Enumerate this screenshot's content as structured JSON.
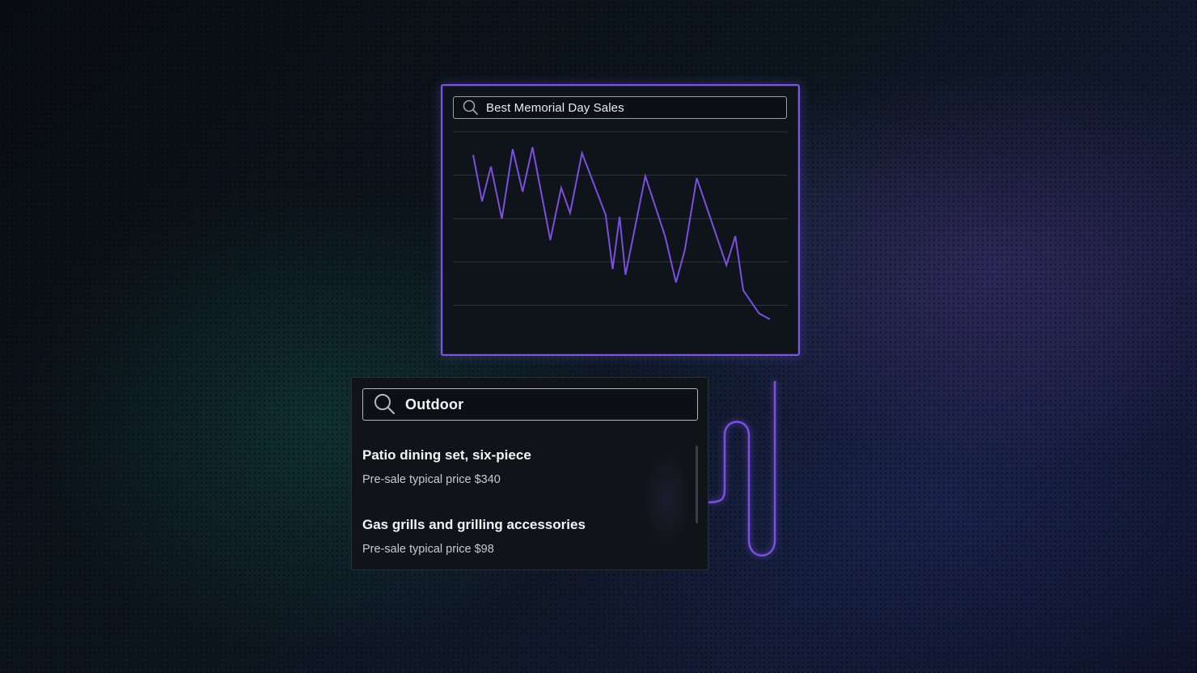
{
  "chart_card": {
    "search_query": "Best Memorial Day Sales",
    "search_icon": "search-icon"
  },
  "chart_data": {
    "type": "line",
    "grid": true,
    "gridlines": 5,
    "ylim": [
      0,
      100
    ],
    "series": [
      {
        "color": "#7b4fe0",
        "values": [
          96,
          72,
          90,
          63,
          99,
          77,
          100,
          52,
          79,
          66,
          97,
          65,
          37,
          64,
          34,
          85,
          54,
          30,
          47,
          84,
          39,
          54,
          26,
          14,
          11
        ]
      }
    ],
    "x": [
      0,
      4.5,
      9,
      14.5,
      20,
      25,
      30,
      39,
      44.5,
      49,
      55,
      67,
      70.5,
      74,
      77,
      87,
      97,
      102.5,
      107,
      113,
      128,
      132.5,
      136.5,
      144.5,
      150
    ]
  },
  "results_card": {
    "search_query": "Outdoor",
    "search_icon": "search-icon",
    "results": [
      {
        "title": "Patio dining set, six-piece",
        "subtitle": "Pre-sale typical price $340"
      },
      {
        "title": "Gas grills and grilling accessories",
        "subtitle": "Pre-sale typical price $98"
      }
    ]
  },
  "colors": {
    "accent": "#7a55e6",
    "line": "#7b4fe0",
    "panel_bg": "#0f141a"
  }
}
